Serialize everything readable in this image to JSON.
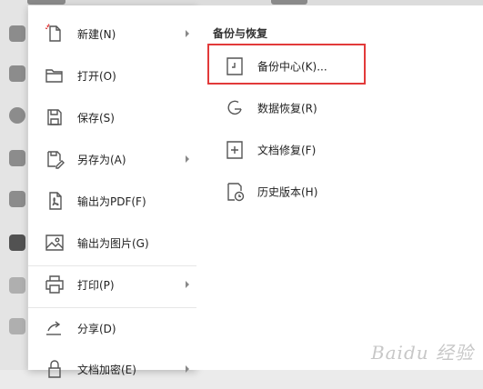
{
  "menu": {
    "items": [
      {
        "label": "新建(N)",
        "icon": "new-document-icon",
        "submenu": true
      },
      {
        "label": "打开(O)",
        "icon": "folder-open-icon",
        "submenu": false
      },
      {
        "label": "保存(S)",
        "icon": "save-icon",
        "submenu": false
      },
      {
        "label": "另存为(A)",
        "icon": "save-as-icon",
        "submenu": true
      },
      {
        "label": "输出为PDF(F)",
        "icon": "export-pdf-icon",
        "submenu": false
      },
      {
        "label": "输出为图片(G)",
        "icon": "export-image-icon",
        "submenu": false
      },
      {
        "label": "打印(P)",
        "icon": "printer-icon",
        "submenu": true
      },
      {
        "label": "分享(D)",
        "icon": "share-icon",
        "submenu": false
      },
      {
        "label": "文档加密(E)",
        "icon": "encrypt-icon",
        "submenu": true
      }
    ]
  },
  "submenu": {
    "title": "备份与恢复",
    "items": [
      {
        "label": "备份中心(K)...",
        "icon": "backup-center-icon"
      },
      {
        "label": "数据恢复(R)",
        "icon": "data-recovery-icon"
      },
      {
        "label": "文档修复(F)",
        "icon": "document-repair-icon"
      },
      {
        "label": "历史版本(H)",
        "icon": "history-version-icon"
      }
    ]
  },
  "watermark": {
    "text": "Baidu 经验"
  },
  "colors": {
    "highlight": "#e23a3a",
    "menu_bg": "#ffffff",
    "background": "#ebebeb"
  }
}
